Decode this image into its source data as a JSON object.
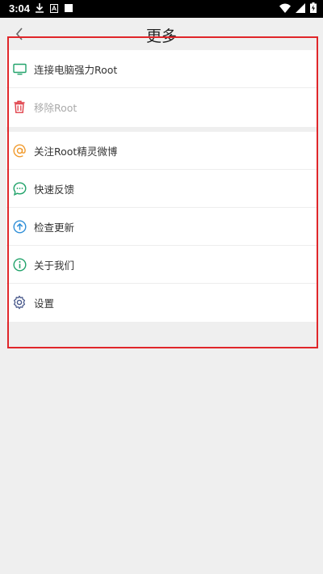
{
  "status_bar": {
    "time": "3:04"
  },
  "header": {
    "title": "更多"
  },
  "group1": [
    {
      "label": "连接电脑强力Root",
      "icon": "monitor-icon",
      "color": "#22a36b"
    },
    {
      "label": "移除Root",
      "icon": "trash-icon",
      "color": "#e0414a",
      "disabled": true
    }
  ],
  "group2": [
    {
      "label": "关注Root精灵微博",
      "icon": "at-icon",
      "color": "#f19a2c"
    },
    {
      "label": "快速反馈",
      "icon": "chat-icon",
      "color": "#22a36b"
    },
    {
      "label": "检查更新",
      "icon": "upload-icon",
      "color": "#2f8fd8"
    },
    {
      "label": "关于我们",
      "icon": "info-icon",
      "color": "#22a36b"
    },
    {
      "label": "设置",
      "icon": "gear-icon",
      "color": "#4a5a8c"
    }
  ]
}
